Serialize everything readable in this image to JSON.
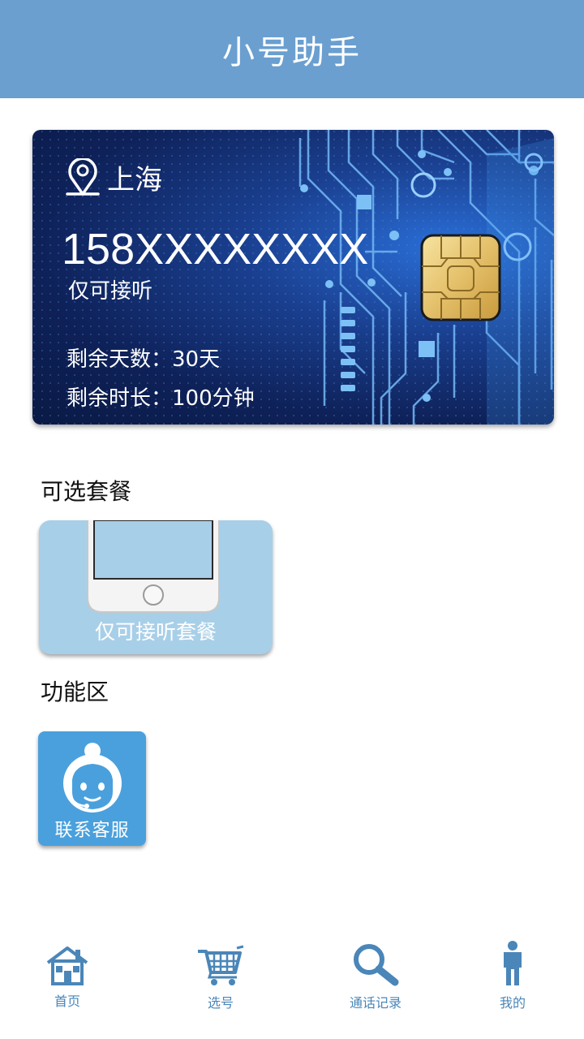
{
  "header": {
    "title": "小号助手"
  },
  "card": {
    "location": "上海",
    "number": "158XXXXXXXX",
    "note": "仅可接听",
    "remaining_days": "剩余天数：30天",
    "remaining_minutes": "剩余时长：100分钟"
  },
  "packages": {
    "section_title": "可选套餐",
    "items": [
      {
        "label": "仅可接听套餐"
      }
    ]
  },
  "functions": {
    "section_title": "功能区",
    "items": [
      {
        "label": "联系客服"
      }
    ]
  },
  "tabbar": {
    "items": [
      {
        "label": "首页",
        "icon": "home-icon"
      },
      {
        "label": "选号",
        "icon": "cart-icon"
      },
      {
        "label": "通话记录",
        "icon": "search-icon"
      },
      {
        "label": "我的",
        "icon": "person-icon"
      }
    ]
  },
  "colors": {
    "header": "#6a9fd0",
    "tab": "#4a86b8",
    "package_card": "#a8cfe8",
    "service_tile": "#4aa0dc"
  }
}
